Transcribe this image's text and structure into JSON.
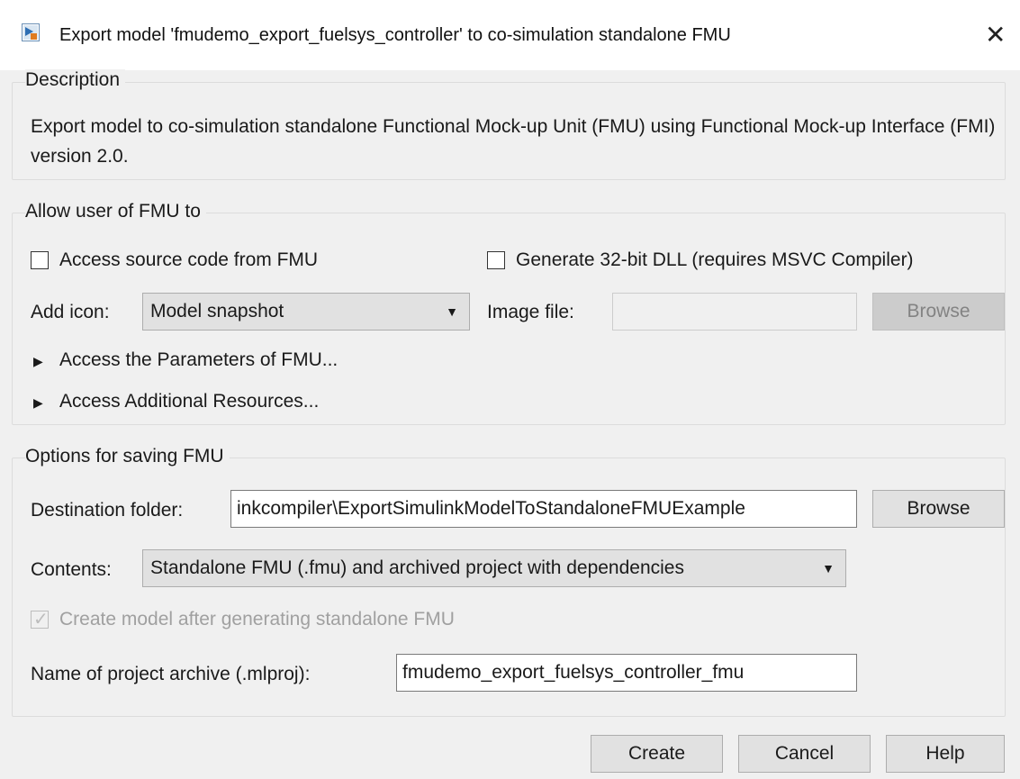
{
  "window": {
    "title": "Export model 'fmudemo_export_fuelsys_controller' to co-simulation standalone FMU",
    "close_glyph": "✕"
  },
  "description": {
    "legend": "Description",
    "text": "Export model to co-simulation standalone Functional Mock-up Unit (FMU) using Functional Mock-up Interface (FMI) version 2.0."
  },
  "allow": {
    "legend": "Allow user of FMU to",
    "access_source": {
      "label": "Access source code from FMU",
      "checked": false
    },
    "generate_32bit": {
      "label": "Generate 32-bit DLL (requires MSVC Compiler)",
      "checked": false
    },
    "add_icon_label": "Add icon:",
    "add_icon_value": "Model snapshot",
    "image_file_label": "Image file:",
    "image_file_value": "",
    "browse_label": "Browse",
    "params_expander": "Access the Parameters of FMU...",
    "resources_expander": "Access Additional Resources..."
  },
  "saving": {
    "legend": "Options for saving FMU",
    "destination_label": "Destination folder:",
    "destination_value": "inkcompiler\\ExportSimulinkModelToStandaloneFMUExample",
    "browse_label": "Browse",
    "contents_label": "Contents:",
    "contents_value": "Standalone FMU (.fmu) and archived project with dependencies",
    "create_model": {
      "label": "Create model after generating standalone FMU",
      "checked": true
    },
    "archive_label": "Name of project archive (.mlproj):",
    "archive_value": "fmudemo_export_fuelsys_controller_fmu"
  },
  "footer": {
    "create_label": "Create",
    "cancel_label": "Cancel",
    "help_label": "Help"
  }
}
